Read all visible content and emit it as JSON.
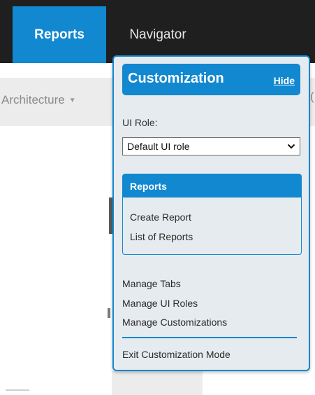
{
  "topnav": {
    "tabs": [
      {
        "label": "Reports",
        "active": true
      },
      {
        "label": "Navigator",
        "active": false
      }
    ]
  },
  "subnav": {
    "item_label": "Architecture",
    "caret": "▼",
    "stub": "("
  },
  "customization": {
    "title": "Customization",
    "hide_label": "Hide",
    "ui_role_label": "UI Role:",
    "ui_role_value": "Default UI role",
    "reports_section": {
      "title": "Reports",
      "links": [
        "Create Report",
        "List of Reports"
      ]
    },
    "menu": [
      "Manage Tabs",
      "Manage UI Roles",
      "Manage Customizations"
    ],
    "exit_label": "Exit Customization Mode"
  },
  "colors": {
    "accent": "#1188d0",
    "topbar": "#1f1f1f",
    "popup_bg": "#e6ebef",
    "subbar": "#ececec"
  }
}
